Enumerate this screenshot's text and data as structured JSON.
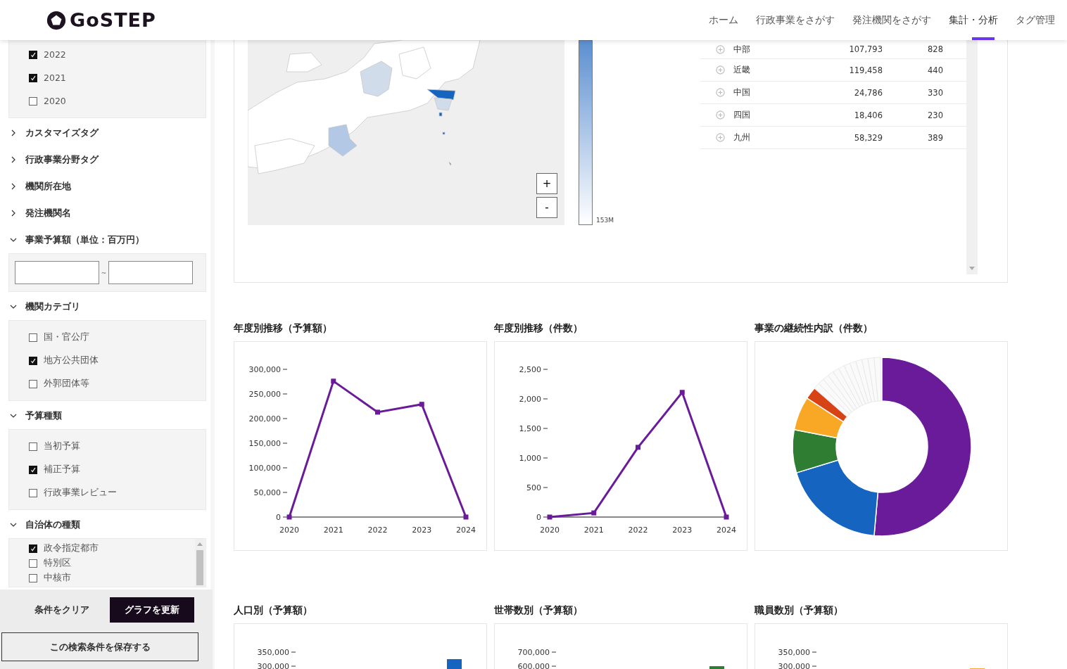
{
  "header": {
    "logo_text": "GoSTEP",
    "nav": [
      {
        "label": "ホーム",
        "selected": false
      },
      {
        "label": "行政事業をさがす",
        "selected": false
      },
      {
        "label": "発注機関をさがす",
        "selected": false
      },
      {
        "label": "集計・分析",
        "selected": true
      },
      {
        "label": "タグ管理",
        "selected": false
      }
    ]
  },
  "sidebar": {
    "year_filter": {
      "items": [
        {
          "label": "2022",
          "checked": true
        },
        {
          "label": "2021",
          "checked": true
        },
        {
          "label": "2020",
          "checked": false
        }
      ]
    },
    "sections": [
      {
        "title": "カスタマイズタグ",
        "expanded": false
      },
      {
        "title": "行政事業分野タグ",
        "expanded": false
      },
      {
        "title": "機関所在地",
        "expanded": false
      },
      {
        "title": "発注機関名",
        "expanded": false
      },
      {
        "title": "事業予算額（単位：百万円）",
        "expanded": true,
        "kind": "range",
        "separator": "~"
      },
      {
        "title": "機関カテゴリ",
        "expanded": true,
        "kind": "checklist",
        "items": [
          {
            "label": "国・官公庁",
            "checked": false
          },
          {
            "label": "地方公共団体",
            "checked": true
          },
          {
            "label": "外郭団体等",
            "checked": false
          }
        ]
      },
      {
        "title": "予算種類",
        "expanded": true,
        "kind": "checklist",
        "items": [
          {
            "label": "当初予算",
            "checked": false
          },
          {
            "label": "補正予算",
            "checked": true
          },
          {
            "label": "行政事業レビュー",
            "checked": false
          }
        ]
      },
      {
        "title": "自治体の種類",
        "expanded": true,
        "kind": "scroll_list",
        "items": [
          {
            "label": "政令指定都市",
            "checked": true
          },
          {
            "label": "特別区",
            "checked": false
          },
          {
            "label": "中核市",
            "checked": false
          }
        ]
      }
    ],
    "actions": {
      "clear": "条件をクリア",
      "update": "グラフを更新",
      "save": "この検索条件を保存する"
    }
  },
  "region_panel": {
    "zoom_in": "+",
    "zoom_out": "-",
    "legend_max": "153M",
    "rows": [
      {
        "cells": [
          "中部",
          "107,793",
          "828"
        ]
      },
      {
        "cells": [
          "近畿",
          "119,458",
          "440"
        ]
      },
      {
        "cells": [
          "中国",
          "24,786",
          "330"
        ]
      },
      {
        "cells": [
          "四国",
          "18,406",
          "230"
        ]
      },
      {
        "cells": [
          "九州",
          "58,329",
          "389"
        ]
      }
    ]
  },
  "charts": [
    {
      "title": "年度別推移（予算額）",
      "kind": "line",
      "chart_data": {
        "type": "line",
        "categories": [
          "2020",
          "2021",
          "2022",
          "2023",
          "2024"
        ],
        "series": [
          {
            "color": "#6a1b9a",
            "marker": "square",
            "values": [
              0,
              276000,
              213000,
              229000,
              0
            ]
          }
        ],
        "ylim": [
          0,
          300000
        ],
        "yticks": [
          {
            "value": 0,
            "label": "0"
          },
          {
            "value": 50000,
            "label": "50,000"
          },
          {
            "value": 100000,
            "label": "100,000"
          },
          {
            "value": 150000,
            "label": "150,000"
          },
          {
            "value": 200000,
            "label": "200,000"
          },
          {
            "value": 250000,
            "label": "250,000"
          },
          {
            "value": 300000,
            "label": "300,000"
          }
        ]
      }
    },
    {
      "title": "年度別推移（件数）",
      "kind": "line",
      "chart_data": {
        "type": "line",
        "categories": [
          "2020",
          "2021",
          "2022",
          "2023",
          "2024"
        ],
        "series": [
          {
            "color": "#6a1b9a",
            "marker": "square",
            "values": [
              0,
              70,
              1180,
              2110,
              0
            ]
          }
        ],
        "ylim": [
          0,
          2500
        ],
        "yticks": [
          {
            "value": 0,
            "label": "0"
          },
          {
            "value": 500,
            "label": "500"
          },
          {
            "value": 1000,
            "label": "1,000"
          },
          {
            "value": 1500,
            "label": "1,500"
          },
          {
            "value": 2000,
            "label": "2,000"
          },
          {
            "value": 2500,
            "label": "2,500"
          }
        ]
      }
    },
    {
      "title": "事業の継続性内訳（件数）",
      "kind": "donut"
    }
  ],
  "lower_charts": [
    {
      "title": "人口別（予算額）",
      "y_tick_labels": [
        "350,000",
        "300,000"
      ],
      "color": "#1565c0"
    },
    {
      "title": "世帯数別（予算額）",
      "y_tick_labels": [
        "700,000",
        "600,000"
      ],
      "color": "#2e7d32"
    },
    {
      "title": "職員数別（予算額）",
      "y_tick_labels": [
        "350,000",
        "300,000"
      ],
      "color": "#f9a825"
    }
  ]
}
